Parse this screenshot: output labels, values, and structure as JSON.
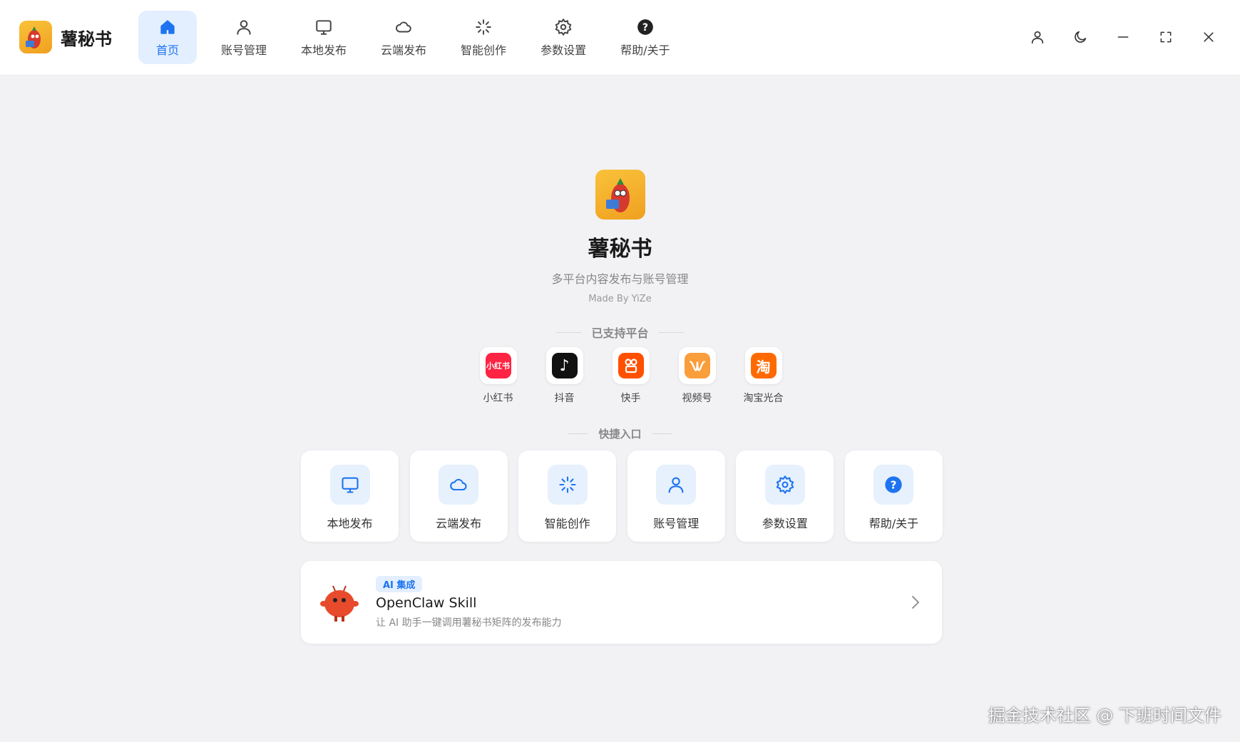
{
  "app": {
    "name": "薯秘书",
    "subtitle": "多平台内容发布与账号管理",
    "made_by": "Made By YiZe"
  },
  "nav": {
    "items": [
      {
        "label": "首页",
        "icon": "home-icon",
        "active": true
      },
      {
        "label": "账号管理",
        "icon": "user-icon"
      },
      {
        "label": "本地发布",
        "icon": "monitor-icon"
      },
      {
        "label": "云端发布",
        "icon": "cloud-icon"
      },
      {
        "label": "智能创作",
        "icon": "sparkle-icon"
      },
      {
        "label": "参数设置",
        "icon": "gear-icon"
      },
      {
        "label": "帮助/关于",
        "icon": "help-icon"
      }
    ]
  },
  "window_controls": [
    "user-icon",
    "moon-icon",
    "minimize-icon",
    "maximize-icon",
    "close-icon"
  ],
  "platforms_section": {
    "title": "已支持平台",
    "items": [
      {
        "label": "小红书",
        "icon_text": "小红书",
        "color": "#ff2442"
      },
      {
        "label": "抖音",
        "icon_text": "♪",
        "color": "#111111"
      },
      {
        "label": "快手",
        "icon_text": "",
        "color": "#ff5000"
      },
      {
        "label": "视频号",
        "icon_text": "",
        "color": "#fa9d3b"
      },
      {
        "label": "淘宝光合",
        "icon_text": "淘",
        "color": "#ff6a00"
      }
    ]
  },
  "quick_section": {
    "title": "快捷入口",
    "items": [
      {
        "label": "本地发布",
        "icon": "monitor-icon"
      },
      {
        "label": "云端发布",
        "icon": "cloud-icon"
      },
      {
        "label": "智能创作",
        "icon": "sparkle-icon"
      },
      {
        "label": "账号管理",
        "icon": "user-icon"
      },
      {
        "label": "参数设置",
        "icon": "gear-icon"
      },
      {
        "label": "帮助/关于",
        "icon": "help-icon"
      }
    ]
  },
  "skill_card": {
    "badge": "AI 集成",
    "name": "OpenClaw Skill",
    "description": "让 AI 助手一键调用薯秘书矩阵的发布能力"
  },
  "watermark": "掘金技术社区 @ 下班时间文件",
  "colors": {
    "accent": "#1e74f0",
    "accent_bg": "#e3efff",
    "page_bg": "#f2f2f5"
  }
}
